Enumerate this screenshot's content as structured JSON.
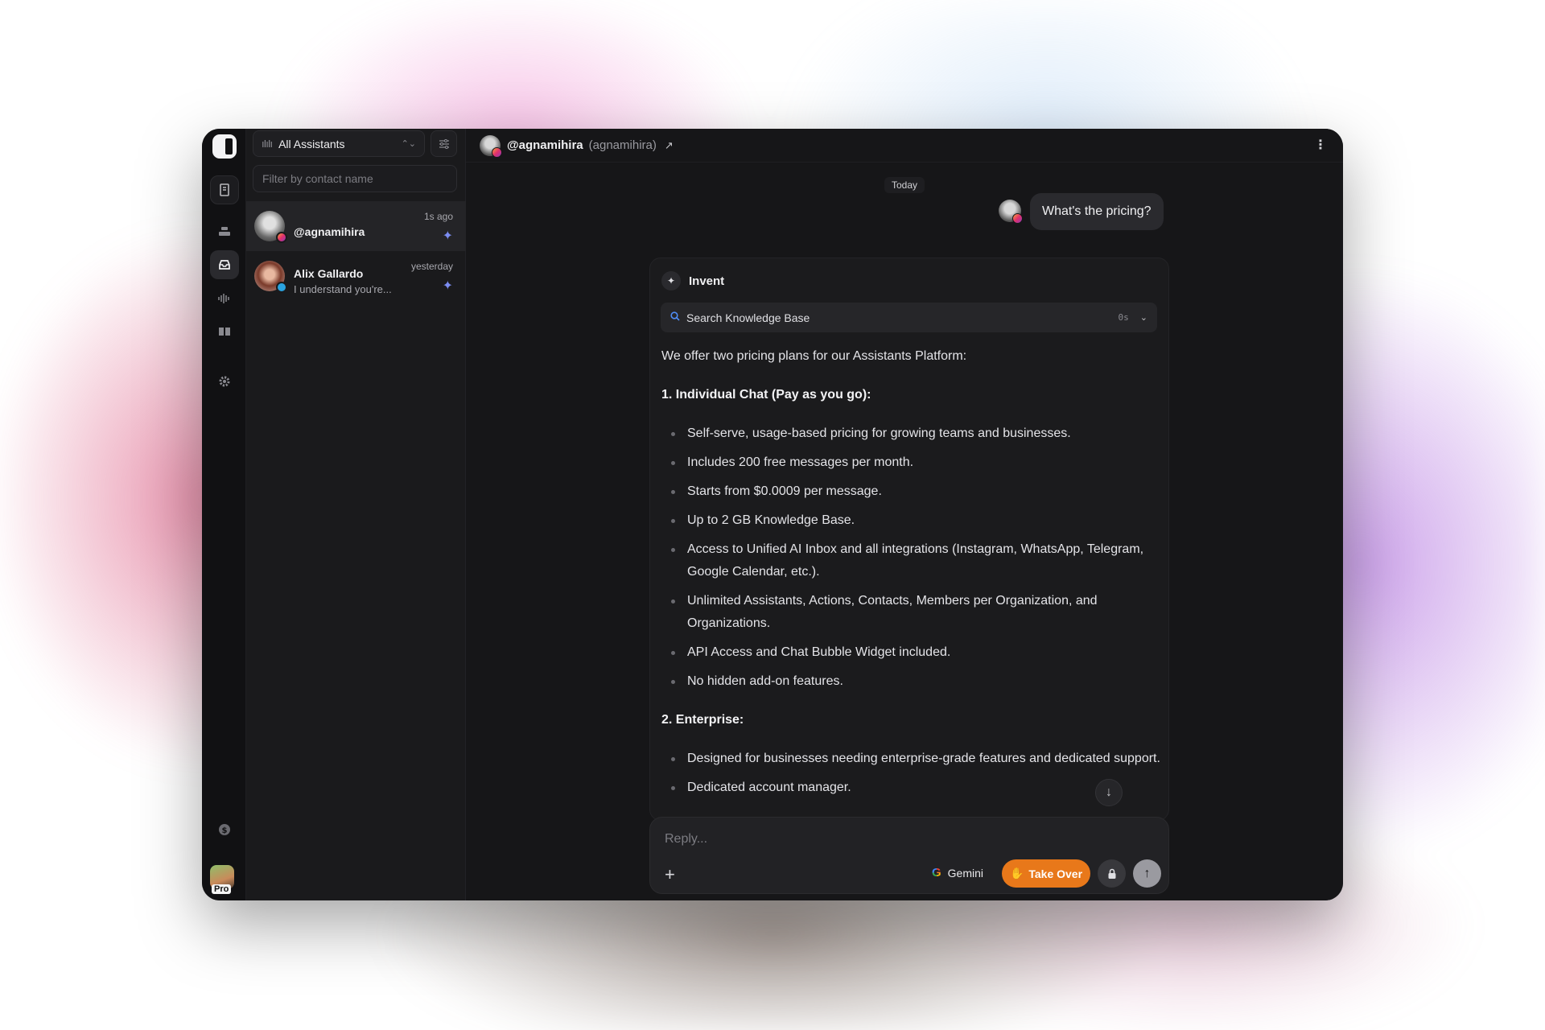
{
  "sidebar_rail": {
    "items": [
      {
        "icon": "panel-toggle-icon"
      },
      {
        "icon": "building-icon"
      },
      {
        "icon": "layers-icon"
      },
      {
        "icon": "inbox-icon",
        "active": true
      },
      {
        "icon": "audio-wave-icon"
      },
      {
        "icon": "book-icon"
      },
      {
        "icon": "gear-icon"
      },
      {
        "icon": "billing-icon"
      }
    ],
    "plan_badge": "Pro"
  },
  "conversation_list": {
    "assistant_selector": "All Assistants",
    "search_placeholder": "Filter by contact name",
    "items": [
      {
        "name": "@agnamihira",
        "preview": "",
        "time": "1s ago",
        "channel": "instagram",
        "active": true
      },
      {
        "name": "Alix Gallardo",
        "preview": "I understand you're...",
        "time": "yesterday",
        "channel": "telegram",
        "active": false
      }
    ]
  },
  "header": {
    "handle": "@agnamihira",
    "username": "(agnamihira)"
  },
  "chat": {
    "date_divider": "Today",
    "user_message": "What's the pricing?",
    "bot_name": "Invent",
    "tool_call": {
      "label": "Search Knowledge Base",
      "duration": "0s"
    },
    "intro": "We offer two pricing plans for our Assistants Platform:",
    "plans": [
      {
        "heading": "1. Individual Chat (Pay as you go):",
        "bullets": [
          "Self-serve, usage-based pricing for growing teams and businesses.",
          "Includes 200 free messages per month.",
          "Starts from $0.0009 per message.",
          "Up to 2 GB Knowledge Base.",
          "Access to Unified AI Inbox and all integrations (Instagram, WhatsApp, Telegram, Google Calendar, etc.).",
          "Unlimited Assistants, Actions, Contacts, Members per Organization, and Organizations.",
          "API Access and Chat Bubble Widget included.",
          "No hidden add-on features."
        ]
      },
      {
        "heading": "2. Enterprise:",
        "bullets": [
          "Designed for businesses needing enterprise-grade features and dedicated support.",
          "Dedicated account manager."
        ]
      }
    ]
  },
  "composer": {
    "placeholder": "Reply...",
    "model": "Gemini",
    "takeover_label": "Take Over"
  },
  "colors": {
    "accent_orange": "#e8781a",
    "window_bg": "#161618",
    "spark_blue": "#7b8cf0"
  }
}
